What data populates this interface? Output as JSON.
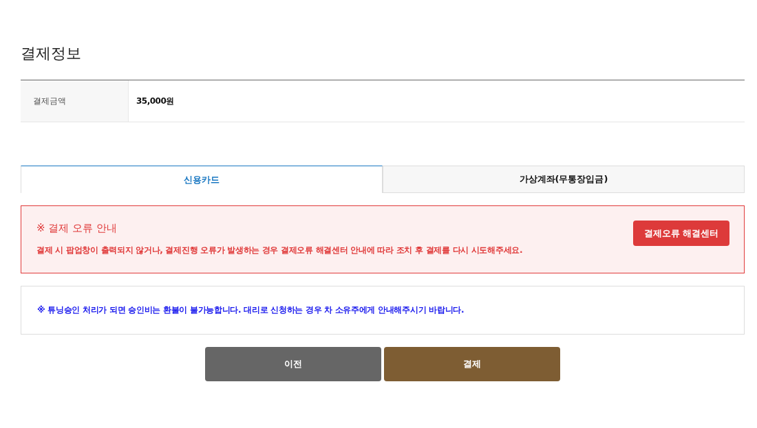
{
  "section_title": "결제정보",
  "payment_table": {
    "rows": [
      {
        "label": "결제금액",
        "value": "35,000원"
      }
    ]
  },
  "tabs": [
    {
      "label": "신용카드",
      "selected": true
    },
    {
      "label": "가상계좌(무통장입금)",
      "selected": false
    }
  ],
  "error_notice": {
    "title": "※ 결제 오류 안내",
    "message": "결제 시 팝업창이 출력되지 않거나, 결제진행 오류가 발생하는 경우 결제오류 해결센터 안내에 따라 조치 후 결제를 다시 시도해주세요.",
    "button": "결제오류 해결센터"
  },
  "tuning_notice": {
    "message": "※ 튜닝승인 처리가 되면 승인비는 환불이 불가능합니다. 대리로 신청하는 경우 차 소유주에게 안내해주시기 바랍니다."
  },
  "buttons": [
    {
      "label": "이전",
      "kind": "secondary"
    },
    {
      "label": "결제",
      "kind": "primary"
    }
  ]
}
